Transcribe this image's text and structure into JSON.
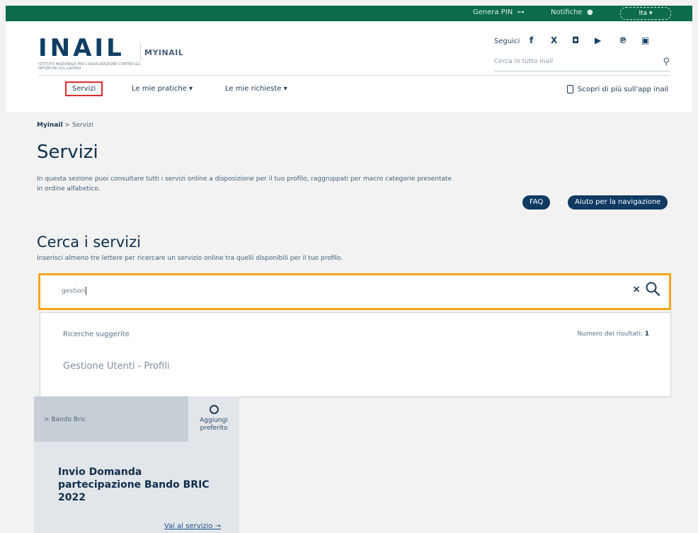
{
  "topbar": {
    "genera_pin": "Genera PIN",
    "genera_pin_icon": "key-icon",
    "notifiche": "Notifiche",
    "notifiche_icon": "bell-icon",
    "lang": "Ita"
  },
  "header": {
    "logo": "INAIL",
    "logo_sub": "ISTITUTO NAZIONALE PER L'ASSICURAZIONE CONTRO GLI INFORTUNI SUL LAVORO",
    "app_name": "MYINAIL",
    "seguici": "Seguici",
    "social": [
      "f",
      "X",
      "◘",
      "▶",
      "℗",
      "▣"
    ],
    "search_placeholder": "Cerca in tutto inail",
    "search_icon": "search-icon"
  },
  "nav": {
    "tabs": [
      "Servizi",
      "Le mie pratiche ▾",
      "Le mie richieste ▾"
    ],
    "app_link": "Scopri di più sull'app inail"
  },
  "breadcrumb": {
    "home": "Myinail",
    "sep": " > ",
    "current": "Servizi"
  },
  "page": {
    "title": "Servizi",
    "intro": "In questa sezione puoi consultare tutti i servizi online a disposizione per il tuo profilo, raggruppati per macro categorie presentate in ordine alfabetico.",
    "faq": "FAQ",
    "aiuto": "Aiuto per la navigazione"
  },
  "search_section": {
    "title": "Cerca i servizi",
    "subtitle": "Inserisci almeno tre lettere per ricercare un servizio online tra quelli disponibili per il tuo profilo.",
    "value": "gestion",
    "clear_icon": "clear-icon",
    "search_icon": "search-icon"
  },
  "dropdown": {
    "header": "Ricerche suggerite",
    "count_label": "Numero dei risultati: ",
    "count": "1",
    "suggestions": [
      "Gestione Utenti - Profili"
    ]
  },
  "card": {
    "tag": "> Bando Bric",
    "fav_label_1": "Aggiungi",
    "fav_label_2": "preferito",
    "title": "Invio Domanda partecipazione Bando BRIC 2022",
    "link": "Vai al servizio →"
  },
  "colors": {
    "topbar": "#0b6b4b",
    "brand": "#0f3a62",
    "highlight": "#e02c2c",
    "search_border": "#f6a51b"
  }
}
